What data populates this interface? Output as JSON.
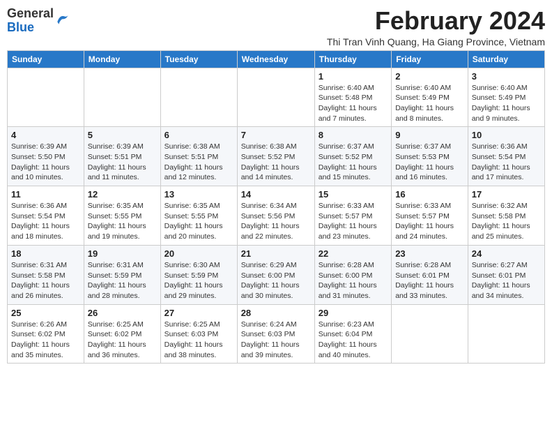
{
  "logo": {
    "general": "General",
    "blue": "Blue"
  },
  "title": "February 2024",
  "subtitle": "Thi Tran Vinh Quang, Ha Giang Province, Vietnam",
  "days_header": [
    "Sunday",
    "Monday",
    "Tuesday",
    "Wednesday",
    "Thursday",
    "Friday",
    "Saturday"
  ],
  "weeks": [
    [
      {
        "day": "",
        "info": ""
      },
      {
        "day": "",
        "info": ""
      },
      {
        "day": "",
        "info": ""
      },
      {
        "day": "",
        "info": ""
      },
      {
        "day": "1",
        "info": "Sunrise: 6:40 AM\nSunset: 5:48 PM\nDaylight: 11 hours\nand 7 minutes."
      },
      {
        "day": "2",
        "info": "Sunrise: 6:40 AM\nSunset: 5:49 PM\nDaylight: 11 hours\nand 8 minutes."
      },
      {
        "day": "3",
        "info": "Sunrise: 6:40 AM\nSunset: 5:49 PM\nDaylight: 11 hours\nand 9 minutes."
      }
    ],
    [
      {
        "day": "4",
        "info": "Sunrise: 6:39 AM\nSunset: 5:50 PM\nDaylight: 11 hours\nand 10 minutes."
      },
      {
        "day": "5",
        "info": "Sunrise: 6:39 AM\nSunset: 5:51 PM\nDaylight: 11 hours\nand 11 minutes."
      },
      {
        "day": "6",
        "info": "Sunrise: 6:38 AM\nSunset: 5:51 PM\nDaylight: 11 hours\nand 12 minutes."
      },
      {
        "day": "7",
        "info": "Sunrise: 6:38 AM\nSunset: 5:52 PM\nDaylight: 11 hours\nand 14 minutes."
      },
      {
        "day": "8",
        "info": "Sunrise: 6:37 AM\nSunset: 5:52 PM\nDaylight: 11 hours\nand 15 minutes."
      },
      {
        "day": "9",
        "info": "Sunrise: 6:37 AM\nSunset: 5:53 PM\nDaylight: 11 hours\nand 16 minutes."
      },
      {
        "day": "10",
        "info": "Sunrise: 6:36 AM\nSunset: 5:54 PM\nDaylight: 11 hours\nand 17 minutes."
      }
    ],
    [
      {
        "day": "11",
        "info": "Sunrise: 6:36 AM\nSunset: 5:54 PM\nDaylight: 11 hours\nand 18 minutes."
      },
      {
        "day": "12",
        "info": "Sunrise: 6:35 AM\nSunset: 5:55 PM\nDaylight: 11 hours\nand 19 minutes."
      },
      {
        "day": "13",
        "info": "Sunrise: 6:35 AM\nSunset: 5:55 PM\nDaylight: 11 hours\nand 20 minutes."
      },
      {
        "day": "14",
        "info": "Sunrise: 6:34 AM\nSunset: 5:56 PM\nDaylight: 11 hours\nand 22 minutes."
      },
      {
        "day": "15",
        "info": "Sunrise: 6:33 AM\nSunset: 5:57 PM\nDaylight: 11 hours\nand 23 minutes."
      },
      {
        "day": "16",
        "info": "Sunrise: 6:33 AM\nSunset: 5:57 PM\nDaylight: 11 hours\nand 24 minutes."
      },
      {
        "day": "17",
        "info": "Sunrise: 6:32 AM\nSunset: 5:58 PM\nDaylight: 11 hours\nand 25 minutes."
      }
    ],
    [
      {
        "day": "18",
        "info": "Sunrise: 6:31 AM\nSunset: 5:58 PM\nDaylight: 11 hours\nand 26 minutes."
      },
      {
        "day": "19",
        "info": "Sunrise: 6:31 AM\nSunset: 5:59 PM\nDaylight: 11 hours\nand 28 minutes."
      },
      {
        "day": "20",
        "info": "Sunrise: 6:30 AM\nSunset: 5:59 PM\nDaylight: 11 hours\nand 29 minutes."
      },
      {
        "day": "21",
        "info": "Sunrise: 6:29 AM\nSunset: 6:00 PM\nDaylight: 11 hours\nand 30 minutes."
      },
      {
        "day": "22",
        "info": "Sunrise: 6:28 AM\nSunset: 6:00 PM\nDaylight: 11 hours\nand 31 minutes."
      },
      {
        "day": "23",
        "info": "Sunrise: 6:28 AM\nSunset: 6:01 PM\nDaylight: 11 hours\nand 33 minutes."
      },
      {
        "day": "24",
        "info": "Sunrise: 6:27 AM\nSunset: 6:01 PM\nDaylight: 11 hours\nand 34 minutes."
      }
    ],
    [
      {
        "day": "25",
        "info": "Sunrise: 6:26 AM\nSunset: 6:02 PM\nDaylight: 11 hours\nand 35 minutes."
      },
      {
        "day": "26",
        "info": "Sunrise: 6:25 AM\nSunset: 6:02 PM\nDaylight: 11 hours\nand 36 minutes."
      },
      {
        "day": "27",
        "info": "Sunrise: 6:25 AM\nSunset: 6:03 PM\nDaylight: 11 hours\nand 38 minutes."
      },
      {
        "day": "28",
        "info": "Sunrise: 6:24 AM\nSunset: 6:03 PM\nDaylight: 11 hours\nand 39 minutes."
      },
      {
        "day": "29",
        "info": "Sunrise: 6:23 AM\nSunset: 6:04 PM\nDaylight: 11 hours\nand 40 minutes."
      },
      {
        "day": "",
        "info": ""
      },
      {
        "day": "",
        "info": ""
      }
    ]
  ]
}
